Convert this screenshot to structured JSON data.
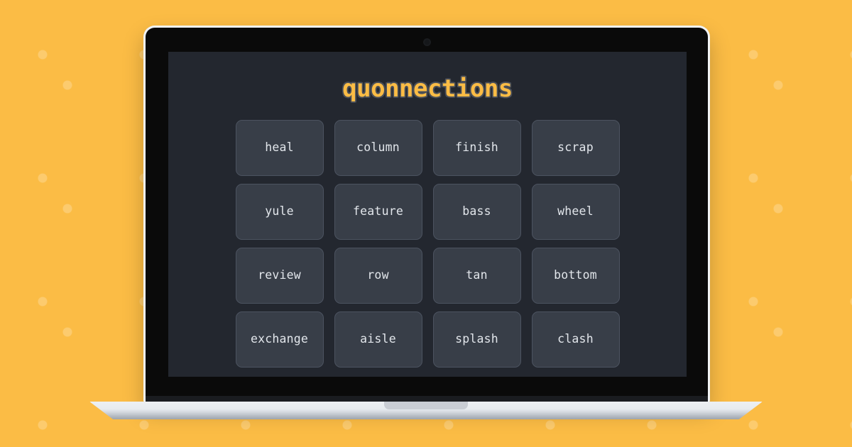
{
  "background": {
    "color": "#FBBC45",
    "dot_color": "rgba(255,255,255,0.22)",
    "pattern": "staggered-dots"
  },
  "device": {
    "kind": "laptop",
    "bezel_color": "#0A0A0A",
    "shell_edge_color": "#F1F3F5",
    "base_color": "#EDF0F3",
    "camera": "webcam-dot"
  },
  "app": {
    "title": "quonnections",
    "title_color": "#FBBC45",
    "screen_color": "#23272F",
    "tile_color": "#383E48",
    "tile_border_color": "#4C5360",
    "tile_text_color": "#E2E6EB",
    "grid": {
      "columns": 4,
      "rows": 4,
      "tiles": [
        {
          "word": "heal"
        },
        {
          "word": "column"
        },
        {
          "word": "finish"
        },
        {
          "word": "scrap"
        },
        {
          "word": "yule"
        },
        {
          "word": "feature"
        },
        {
          "word": "bass"
        },
        {
          "word": "wheel"
        },
        {
          "word": "review"
        },
        {
          "word": "row"
        },
        {
          "word": "tan"
        },
        {
          "word": "bottom"
        },
        {
          "word": "exchange"
        },
        {
          "word": "aisle"
        },
        {
          "word": "splash"
        },
        {
          "word": "clash"
        }
      ]
    }
  }
}
